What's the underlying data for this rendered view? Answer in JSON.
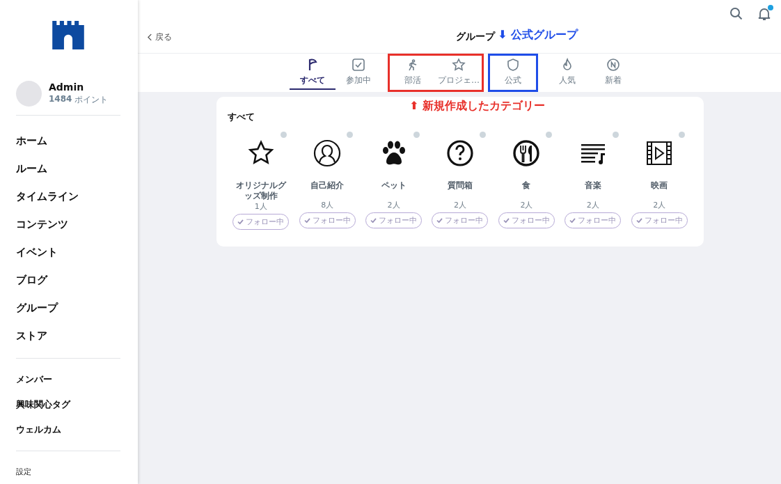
{
  "sidebar": {
    "user": {
      "name": "Admin",
      "points": "1484",
      "points_unit": "ポイント"
    },
    "main_menu": [
      "ホーム",
      "ルーム",
      "タイムライン",
      "コンテンツ",
      "イベント",
      "ブログ",
      "グループ",
      "ストア"
    ],
    "sub_menu": [
      "メンバー",
      "興味関心タグ",
      "ウェルカム"
    ],
    "settings": "設定"
  },
  "header": {
    "notification_unread": true
  },
  "page": {
    "back": "戻る",
    "title": "グループ"
  },
  "tab_groups": [
    {
      "tabs": [
        {
          "label": "すべて",
          "kind": "flag",
          "selected": true
        },
        {
          "label": "参加中",
          "kind": "check",
          "selected": false
        }
      ]
    },
    {
      "color": "#e8302a",
      "tabs": [
        {
          "label": "部活",
          "kind": "run",
          "selected": false
        },
        {
          "label": "プロジェ…",
          "kind": "star",
          "selected": false
        }
      ]
    },
    {
      "color": "#1f4de8",
      "tabs": [
        {
          "label": "公式",
          "kind": "shield",
          "selected": false
        }
      ]
    },
    {
      "tabs": [
        {
          "label": "人気",
          "kind": "fire",
          "selected": false
        },
        {
          "label": "新着",
          "kind": "new",
          "selected": false
        }
      ]
    }
  ],
  "annotations": [
    {
      "text": "⬇ 公式グループ",
      "color": "#1f4de8"
    },
    {
      "text": "⬆ 新規作成したカテゴリー",
      "color": "#e8302a"
    }
  ],
  "section": {
    "title": "すべて",
    "categories": [
      {
        "name": "オリジナルグッズ制作",
        "count": "1人",
        "kind": "star",
        "follow": "フォロー中"
      },
      {
        "name": "自己紹介",
        "count": "8人",
        "kind": "person",
        "follow": "フォロー中"
      },
      {
        "name": "ペット",
        "count": "2人",
        "kind": "paw",
        "follow": "フォロー中"
      },
      {
        "name": "質問箱",
        "count": "2人",
        "kind": "question",
        "follow": "フォロー中"
      },
      {
        "name": "食",
        "count": "2人",
        "kind": "food",
        "follow": "フォロー中"
      },
      {
        "name": "音楽",
        "count": "2人",
        "kind": "music",
        "follow": "フォロー中"
      },
      {
        "name": "映画",
        "count": "2人",
        "kind": "film",
        "follow": "フォロー中"
      }
    ]
  }
}
